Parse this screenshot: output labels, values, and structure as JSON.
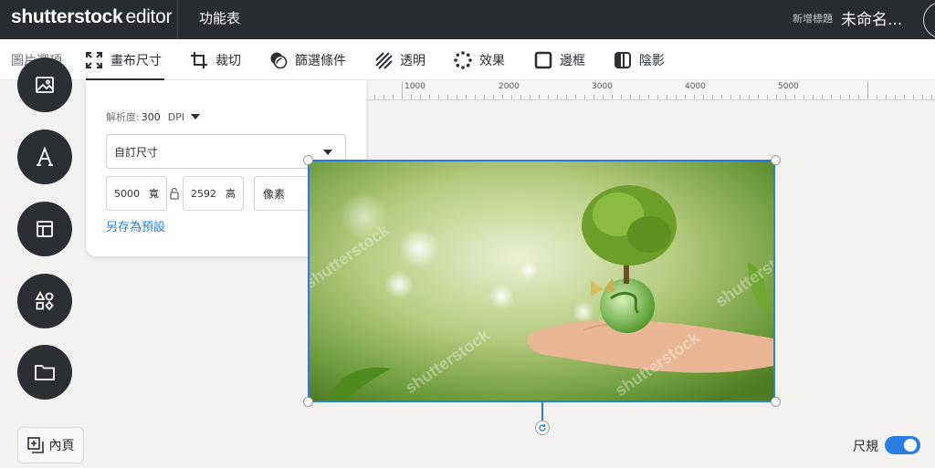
{
  "topbar": {
    "logo_main": "shutterstock",
    "logo_sub": "editor",
    "menu_label": "功能表",
    "add_title_label": "新增標題",
    "document_name": "未命名..."
  },
  "toolbar": {
    "tools": [
      {
        "label": "圖片選項",
        "icon": "none"
      },
      {
        "label": "畫布尺寸",
        "icon": "expand-icon"
      },
      {
        "label": "裁切",
        "icon": "crop-icon"
      },
      {
        "label": "篩選條件",
        "icon": "filter-icon"
      },
      {
        "label": "透明",
        "icon": "transparency-icon"
      },
      {
        "label": "效果",
        "icon": "effects-icon"
      },
      {
        "label": "邊框",
        "icon": "border-icon"
      },
      {
        "label": "陰影",
        "icon": "shadow-icon"
      }
    ],
    "active_tool": "畫布尺寸"
  },
  "ruler": {
    "labels": [
      "1000",
      "2000",
      "3000",
      "4000",
      "5000"
    ]
  },
  "size_panel": {
    "resolution_label": "解析度:",
    "resolution_value": "300",
    "resolution_unit": "DPI",
    "preset_value": "自訂尺寸",
    "width_value": "5000",
    "width_label": "寬",
    "height_value": "2592",
    "height_label": "高",
    "unit_value": "像素",
    "save_preset_link": "另存為預設"
  },
  "sidebar": {
    "buttons": [
      "image-icon",
      "text-icon",
      "layout-icon",
      "shapes-icon",
      "folder-icon"
    ],
    "pages_label": "內頁"
  },
  "ruler_toggle": {
    "label": "尺規",
    "on": true
  },
  "colors": {
    "topbar_bg": "#282b30",
    "accent": "#2a7de1",
    "link": "#2c7fd6"
  }
}
